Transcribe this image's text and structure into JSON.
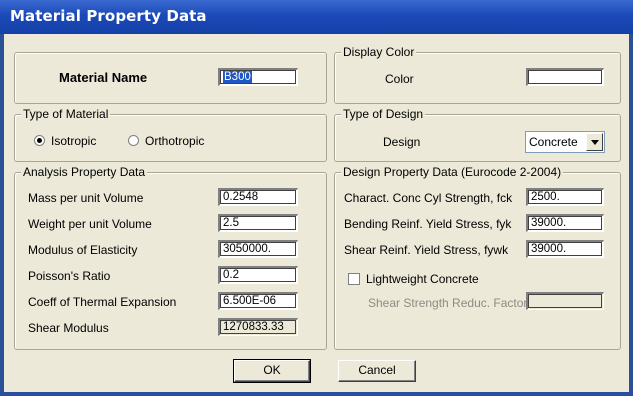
{
  "window": {
    "title": "Material Property Data"
  },
  "material_name": {
    "label": "Material Name",
    "value": "B300"
  },
  "display_color": {
    "legend": "Display Color",
    "label": "Color",
    "value": ""
  },
  "type_of_material": {
    "legend": "Type of Material",
    "options": [
      "Isotropic",
      "Orthotropic"
    ],
    "selected": "Isotropic"
  },
  "type_of_design": {
    "legend": "Type of Design",
    "label": "Design",
    "value": "Concrete"
  },
  "analysis": {
    "legend": "Analysis Property Data",
    "fields": [
      {
        "label": "Mass per unit Volume",
        "value": "0.2548"
      },
      {
        "label": "Weight per unit Volume",
        "value": "2.5"
      },
      {
        "label": "Modulus of Elasticity",
        "value": "3050000."
      },
      {
        "label": "Poisson's Ratio",
        "value": "0.2"
      },
      {
        "label": "Coeff of Thermal Expansion",
        "value": "6.500E-06"
      },
      {
        "label": "Shear Modulus",
        "value": "1270833.33"
      }
    ]
  },
  "design": {
    "legend": "Design Property Data (Eurocode 2-2004)",
    "fields": [
      {
        "label": "Charact. Conc Cyl Strength, fck",
        "value": "2500."
      },
      {
        "label": "Bending Reinf. Yield Stress, fyk",
        "value": "39000."
      },
      {
        "label": "Shear Reinf. Yield Stress, fywk",
        "value": "39000."
      }
    ],
    "lightweight_label": "Lightweight Concrete",
    "lightweight_checked": false,
    "shear_reduc_label": "Shear Strength Reduc. Factor",
    "shear_reduc_value": ""
  },
  "buttons": {
    "ok": "OK",
    "cancel": "Cancel"
  }
}
